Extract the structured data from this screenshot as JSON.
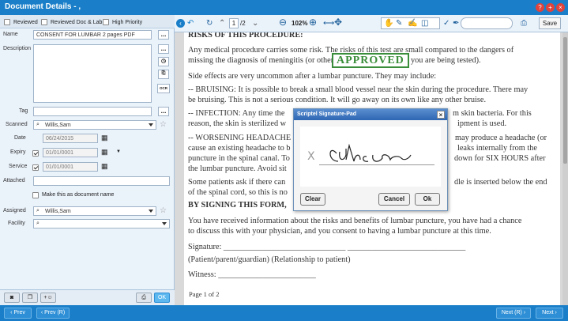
{
  "window": {
    "title": "Document Details - ,"
  },
  "flags": {
    "reviewed": "Reviewed",
    "reviewed_doc_lab": "Reviewed Doc & Lab",
    "high_priority": "High Priority"
  },
  "form": {
    "name_label": "Name",
    "name_value": "CONSENT FOR LUMBAR 2 pages PDF",
    "description_label": "Description",
    "ocr_label": "OCR",
    "tag_label": "Tag",
    "scanned_label": "Scanned",
    "scanned_value": "Willis,Sam",
    "date_label": "Date",
    "date_value": "06/24/2015",
    "expiry_label": "Expiry",
    "expiry_value": "01/01/0001",
    "service_label": "Service",
    "service_value": "01/01/0001",
    "attached_label": "Attached",
    "make_doc_name_label": "Make this as document name",
    "assigned_label": "Assigned",
    "assigned_value": "Willis,Sam",
    "facility_label": "Facility",
    "dots": "..."
  },
  "left_footer": {
    "ok": "OK"
  },
  "toolbar": {
    "page_current": "1",
    "page_total": "/2",
    "zoom": "102%",
    "save": "Save"
  },
  "document": {
    "heading": "RISKS OF THIS PROCEDURE:",
    "p1a": "Any medical procedure carries some risk. The risks of this test are small compared to the dangers of",
    "p1b": "missing the diagnosis of meningitis (or other",
    "p1c": "you are being tested).",
    "stamp": "APPROVED",
    "p2": "Side effects are very uncommon after a lumbar puncture. They may include:",
    "p3a": "-- BRUISING: It is possible to break a small blood vessel near the skin during the procedure. There may",
    "p3b": "be bruising. This is not a serious condition. It will go away on its own like any other bruise.",
    "p4a": "-- INFECTION: Any time the",
    "p4a2": "m skin bacteria. For this",
    "p4b": "reason, the skin is sterilized w",
    "p4b2": "ipment is used.",
    "p5a": "-- WORSENING HEADACHE",
    "p5a2": "may produce a headache (or",
    "p5b": "cause an existing headache to b",
    "p5b2": "leaks internally from the",
    "p5c": "puncture in the spinal canal. To",
    "p5c2": "down for SIX HOURS after",
    "p5d": "the lumbar puncture. Avoid sit",
    "p6a": "Some patients ask if there can",
    "p6a2": "dle is inserted below the end",
    "p6b": "of the spinal cord, so this is no",
    "heading2": "BY SIGNING THIS FORM,",
    "p7a": "You have received information about the risks and benefits of lumbar puncture, you have had a chance",
    "p7b": "to discuss this with your physician, and you consent to having a lumbar puncture at this time.",
    "sig1": "Signature: ______________________________   _____________________________",
    "sig2": "(Patient/parent/guardian) (Relationship to patient)",
    "sig3": "Witness: ________________________",
    "pageno": "Page 1 of 2"
  },
  "signature_pad": {
    "title": "Scriptel Signature-Pad",
    "x_mark": "X",
    "clear": "Clear",
    "cancel": "Cancel",
    "ok": "Ok"
  },
  "footer": {
    "prev": "Prev",
    "prev_r": "Prev (R)",
    "next_r": "Next (R)",
    "next": "Next"
  }
}
